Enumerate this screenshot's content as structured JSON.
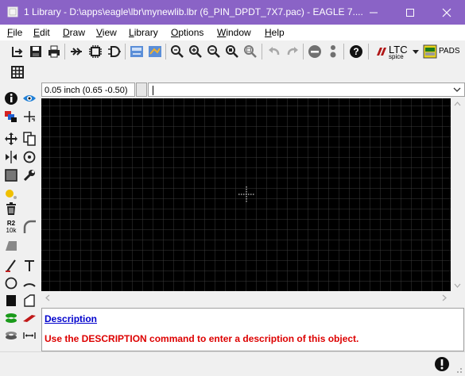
{
  "window": {
    "title": "1 Library - D:\\apps\\eagle\\lbr\\mynewlib.lbr (6_PIN_DPDT_7X7.pac) - EAGLE 7....",
    "accent_color": "#8a63c6"
  },
  "menu": [
    {
      "label": "File",
      "mnemonic": "F"
    },
    {
      "label": "Edit",
      "mnemonic": "E"
    },
    {
      "label": "Draw",
      "mnemonic": "D"
    },
    {
      "label": "View",
      "mnemonic": "V"
    },
    {
      "label": "Library",
      "mnemonic": "L"
    },
    {
      "label": "Options",
      "mnemonic": "O"
    },
    {
      "label": "Window",
      "mnemonic": "W"
    },
    {
      "label": "Help",
      "mnemonic": "H"
    }
  ],
  "toolbar": {
    "ltc_label": "LTC",
    "ltc_sub": "spice",
    "pads_label": "PADS"
  },
  "coords": {
    "value": "0.05 inch (0.65 -0.50)"
  },
  "command": {
    "value": ""
  },
  "leftbar": {
    "value_label_top": "R2",
    "value_label_bottom": "10k"
  },
  "description": {
    "link": "Description",
    "message": "Use the DESCRIPTION command to enter a description of this object."
  },
  "colors": {
    "canvas_bg": "#000000",
    "grid": "#3a3a3a",
    "cursor": "#ffffff",
    "description_link": "#0000cc",
    "description_message": "#dd0000"
  }
}
